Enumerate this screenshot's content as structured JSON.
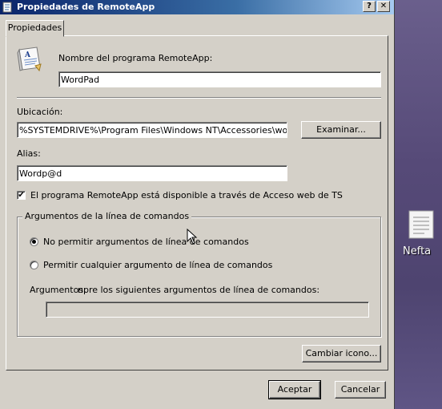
{
  "window": {
    "title": "Propiedades de RemoteApp",
    "help_glyph": "?",
    "close_glyph": "✕"
  },
  "tab": {
    "label": "Propiedades"
  },
  "program": {
    "name_label": "Nombre del programa RemoteApp:",
    "name_value": "WordPad"
  },
  "location": {
    "label": "Ubicación:",
    "value": "%SYSTEMDRIVE%\\Program Files\\Windows NT\\Accessories\\wordpad",
    "browse_label": "Examinar..."
  },
  "alias": {
    "label": "Alias:",
    "value": "Wordp@d"
  },
  "web_access": {
    "label": "El programa RemoteApp está disponible a través de Acceso web de TS",
    "checked": true,
    "check_glyph": "✔"
  },
  "arguments": {
    "group_title": "Argumentos de la línea de comandos",
    "option_none": "No permitir argumentos de línea de comandos",
    "option_any": "Permitir cualquier argumento de línea de comandos",
    "args_label": "Argumentos:",
    "args_overflow_text": "npre los siguientes argumentos de línea de comandos:",
    "args_value": ""
  },
  "change_icon_label": "Cambiar icono...",
  "footer": {
    "ok_label": "Aceptar",
    "cancel_label": "Cancelar"
  },
  "desktop": {
    "icon_label": "Nefta"
  }
}
